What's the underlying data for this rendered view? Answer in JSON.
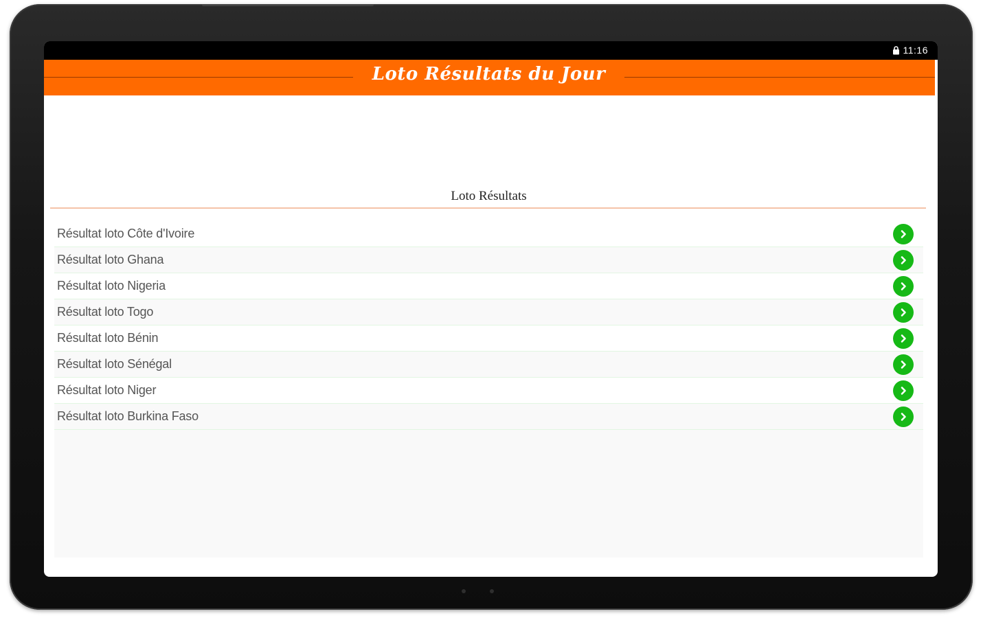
{
  "status_bar": {
    "time": "11:16",
    "lock_icon": "lock-icon"
  },
  "header": {
    "title": "Loto Résultats du Jour",
    "background_color": "#ff6a00"
  },
  "section": {
    "title": "Loto Résultats"
  },
  "list": {
    "items": [
      {
        "label": "Résultat loto Côte d'Ivoire",
        "icon": "chevron-right-icon"
      },
      {
        "label": "Résultat loto Ghana",
        "icon": "chevron-right-icon"
      },
      {
        "label": "Résultat loto Nigeria",
        "icon": "chevron-right-icon"
      },
      {
        "label": "Résultat loto Togo",
        "icon": "chevron-right-icon"
      },
      {
        "label": "Résultat loto Bénin",
        "icon": "chevron-right-icon"
      },
      {
        "label": "Résultat loto Sénégal",
        "icon": "chevron-right-icon"
      },
      {
        "label": "Résultat loto Niger",
        "icon": "chevron-right-icon"
      },
      {
        "label": "Résultat loto Burkina Faso",
        "icon": "chevron-right-icon"
      }
    ],
    "arrow_color": "#16b916"
  }
}
